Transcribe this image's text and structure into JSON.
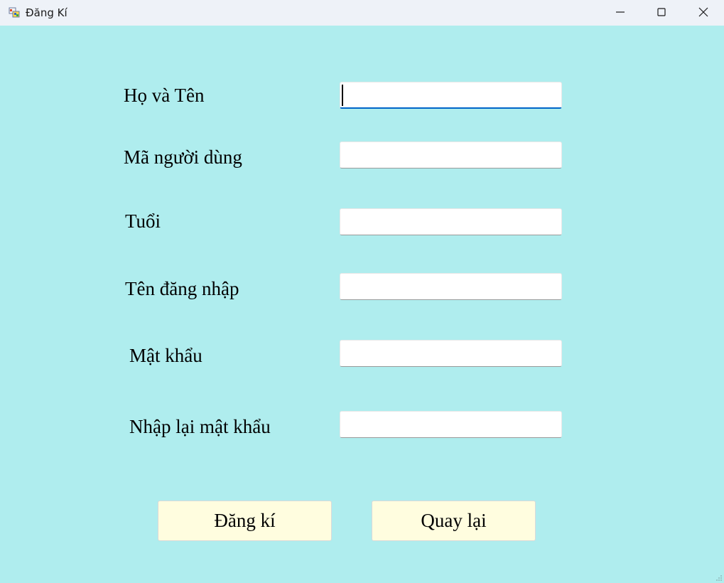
{
  "window": {
    "title": "Đăng Kí",
    "icon": "winforms-app-icon",
    "controls": {
      "minimize": "minimize-icon",
      "maximize": "maximize-icon",
      "close": "close-icon"
    }
  },
  "form": {
    "fields": [
      {
        "label": "Họ và Tên",
        "value": "",
        "focused": true
      },
      {
        "label": "Mã người dùng",
        "value": ""
      },
      {
        "label": "Tuổi",
        "value": ""
      },
      {
        "label": "Tên đăng nhập",
        "value": ""
      },
      {
        "label": "Mật khẩu",
        "value": ""
      },
      {
        "label": "Nhập lại mật khẩu",
        "value": ""
      }
    ],
    "buttons": {
      "register": "Đăng kí",
      "back": "Quay lại"
    }
  },
  "colors": {
    "background": "#afedee",
    "button": "#fffddf",
    "focus_accent": "#0064c8",
    "titlebar": "#eef2f8"
  }
}
